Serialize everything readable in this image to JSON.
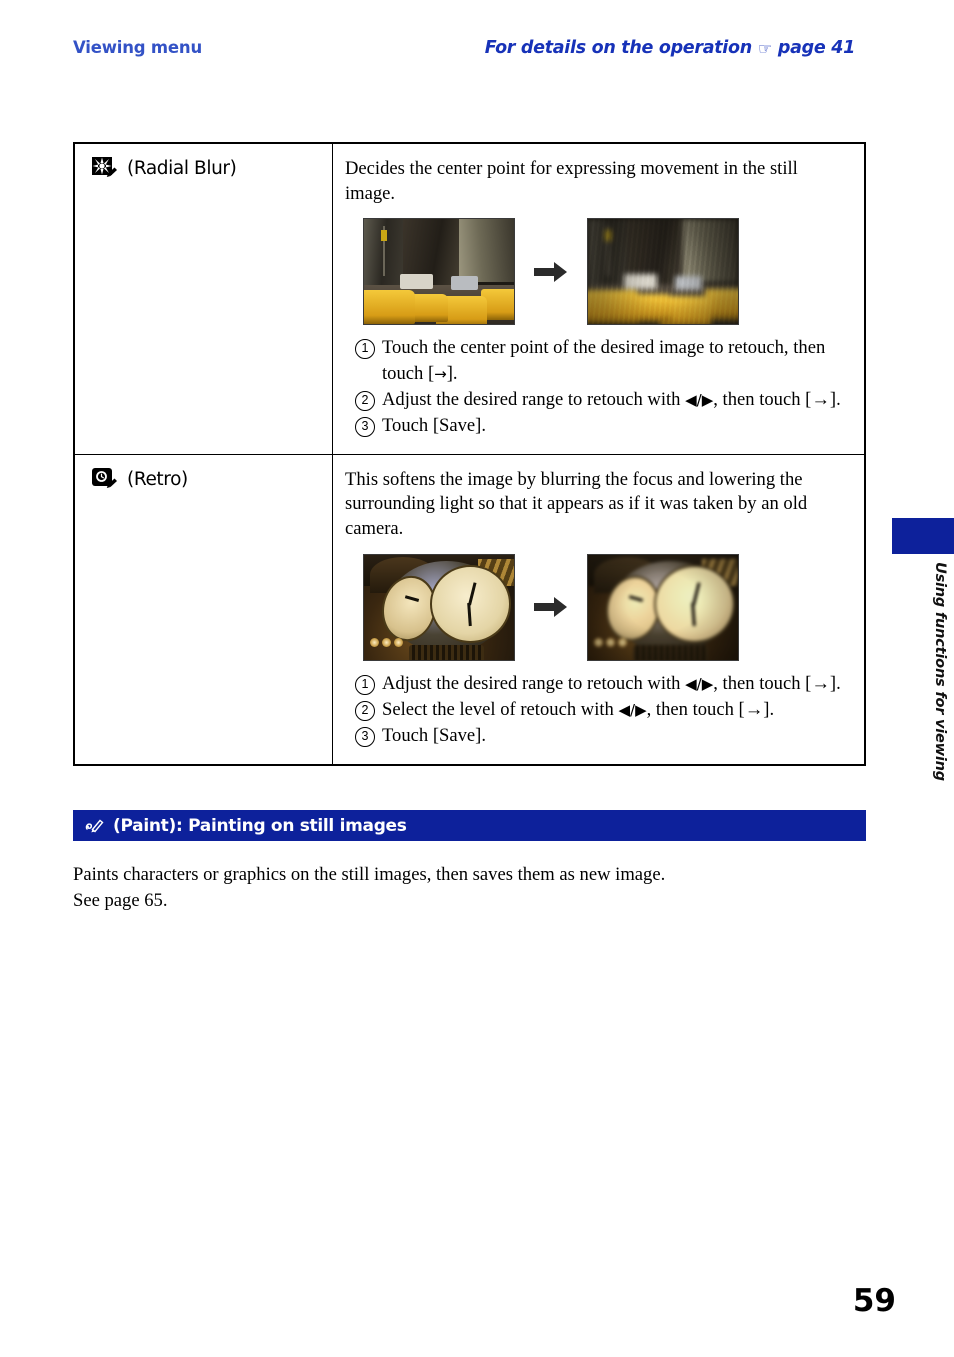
{
  "header": {
    "left_title": "Viewing menu",
    "right_title_pre": "For details on the operation",
    "pointer_icon": "☞",
    "right_title_post": "page 41"
  },
  "table": {
    "rows": [
      {
        "icon_name": "radial-blur-icon",
        "name": "(Radial Blur)",
        "description": "Decides the center point for expressing movement in the still image.",
        "sample_before_alt": "street scene with yellow taxis",
        "sample_after_alt": "same street scene with radial blur applied",
        "arrow_icon": "right-arrow-icon",
        "steps": [
          {
            "num": "1",
            "pre": "Touch the center point of the desired image to retouch, then touch [",
            "glyph": "→",
            "post": "]."
          },
          {
            "num": "2",
            "pre": "Adjust the desired range to retouch with ",
            "glyph": "◀/▶",
            "post": ", then touch [→]."
          },
          {
            "num": "3",
            "pre": "Touch [Save].",
            "glyph": "",
            "post": ""
          }
        ]
      },
      {
        "icon_name": "retro-icon",
        "name": "(Retro)",
        "description": "This softens the image by blurring the focus and lowering the surrounding light so that it appears as if it was taken by an old camera.",
        "sample_before_alt": "brass station clock",
        "sample_after_alt": "same clock with retro effect applied",
        "arrow_icon": "right-arrow-icon",
        "steps": [
          {
            "num": "1",
            "pre": "Adjust the desired range to retouch with ",
            "glyph": "◀/▶",
            "post": ", then touch [→]."
          },
          {
            "num": "2",
            "pre": "Select the level of retouch with ",
            "glyph": "◀/▶",
            "post": ", then touch [→]."
          },
          {
            "num": "3",
            "pre": "Touch [Save].",
            "glyph": "",
            "post": ""
          }
        ]
      }
    ]
  },
  "section": {
    "icon": "✎",
    "title": "(Paint): Painting on still images",
    "body_line1": "Paints characters or graphics on the still images, then saves them as new image.",
    "body_line2": "See page 65."
  },
  "side": {
    "tab_label": "Using functions for viewing"
  },
  "page_number": "59",
  "colors": {
    "header_blue": "#3352c6",
    "header_blue_italic": "#1732b8",
    "section_navy": "#0d219b",
    "rule_black": "#000000"
  }
}
